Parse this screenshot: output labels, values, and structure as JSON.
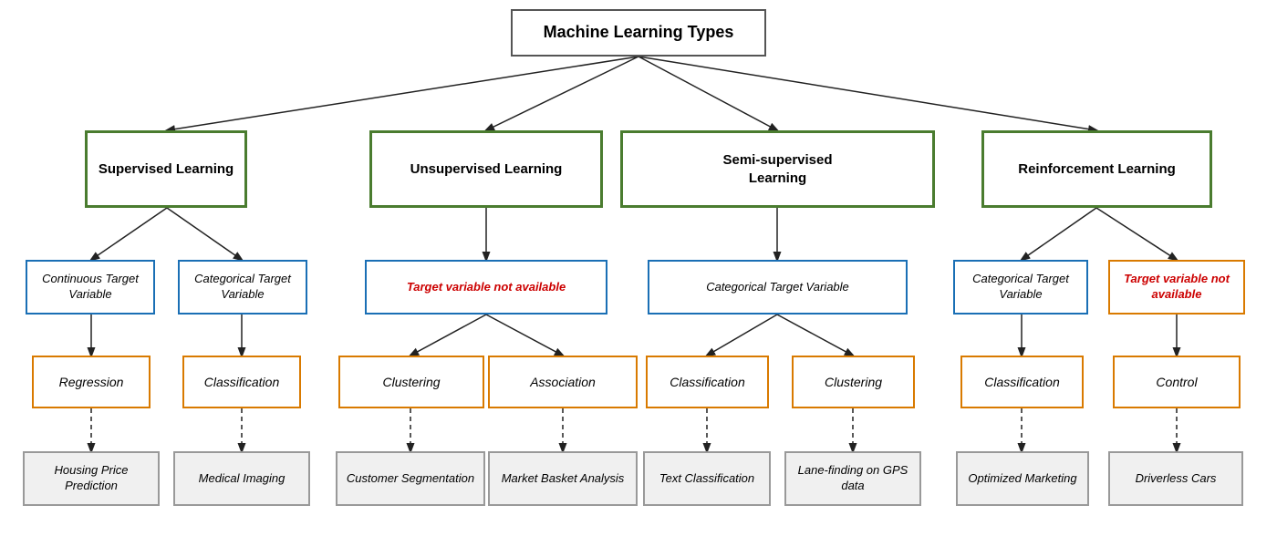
{
  "title": "Machine Learning Types",
  "nodes": {
    "root": {
      "label": "Machine Learning Types"
    },
    "supervised": {
      "label": "Supervised Learning"
    },
    "unsupervised": {
      "label": "Unsupervised\nLearning"
    },
    "semi": {
      "label": "Semi-supervised\nLearning"
    },
    "reinforcement": {
      "label": "Reinforcement\nLearning"
    },
    "continuous": {
      "label": "Continuous\nTarget Variable"
    },
    "categorical_sup": {
      "label": "Categorical\nTarget Variable"
    },
    "target_not_avail_unsup": {
      "label": "Target variable not available"
    },
    "categorical_semi": {
      "label": "Categorical Target Variable"
    },
    "categorical_rl": {
      "label": "Categorical\nTarget Variable"
    },
    "target_not_avail_rl": {
      "label": "Target variable\nnot available"
    },
    "regression": {
      "label": "Regression"
    },
    "classification_sup": {
      "label": "Classification"
    },
    "clustering_unsup": {
      "label": "Clustering"
    },
    "association": {
      "label": "Association"
    },
    "classification_semi": {
      "label": "Classification"
    },
    "clustering_semi": {
      "label": "Clustering"
    },
    "classification_rl": {
      "label": "Classification"
    },
    "control": {
      "label": "Control"
    },
    "housing": {
      "label": "Housing Price\nPrediction"
    },
    "medical": {
      "label": "Medical\nImaging"
    },
    "customer": {
      "label": "Customer\nSegmentation"
    },
    "market": {
      "label": "Market Basket\nAnalysis"
    },
    "text_class": {
      "label": "Text\nClassification"
    },
    "lane": {
      "label": "Lane-finding\non GPS data"
    },
    "optimized": {
      "label": "Optimized\nMarketing"
    },
    "driverless": {
      "label": "Driverless Cars"
    }
  }
}
